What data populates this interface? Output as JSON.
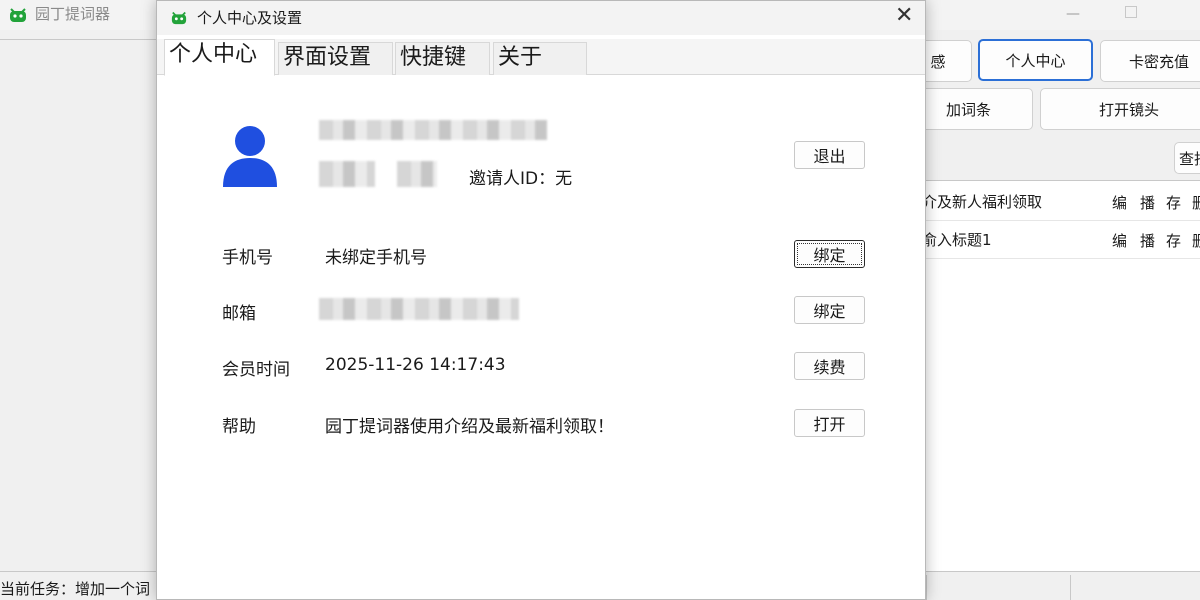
{
  "main": {
    "title": "园丁提词器",
    "buttons": [
      "感",
      "个人中心",
      "卡密充值",
      "加词条",
      "打开镜头",
      "查找"
    ],
    "list": [
      {
        "title": "介及新人福利领取",
        "actions": [
          "编",
          "播",
          "存",
          "删"
        ]
      },
      {
        "title": "俞入标题1",
        "actions": [
          "编",
          "播",
          "存",
          "删"
        ]
      }
    ],
    "status_text": "当前任务：增加一个词"
  },
  "dialog": {
    "title": "个人中心及设置",
    "tabs": [
      "个人中心",
      "界面设置",
      "快捷键",
      "关于"
    ],
    "profile": {
      "inviter": "邀请人ID：无",
      "logout": "退出"
    },
    "rows": [
      {
        "label": "手机号",
        "value": "未绑定手机号",
        "button": "绑定"
      },
      {
        "label": "邮箱",
        "value": "",
        "button": "绑定"
      },
      {
        "label": "会员时间",
        "value": "2025-11-26 14:17:43",
        "button": "续费"
      },
      {
        "label": "帮助",
        "value": "园丁提词器使用介绍及最新福利领取！",
        "button": "打开"
      }
    ]
  },
  "colors": {
    "accent": "#2b6fd6",
    "avatar": "#1f4fe0",
    "app_icon": "#22a33a"
  },
  "icons": {
    "app": "robot-logo-icon",
    "close": "close-icon",
    "minimize": "minimize-icon",
    "maximize": "maximize-icon",
    "avatar": "user-avatar-icon"
  }
}
